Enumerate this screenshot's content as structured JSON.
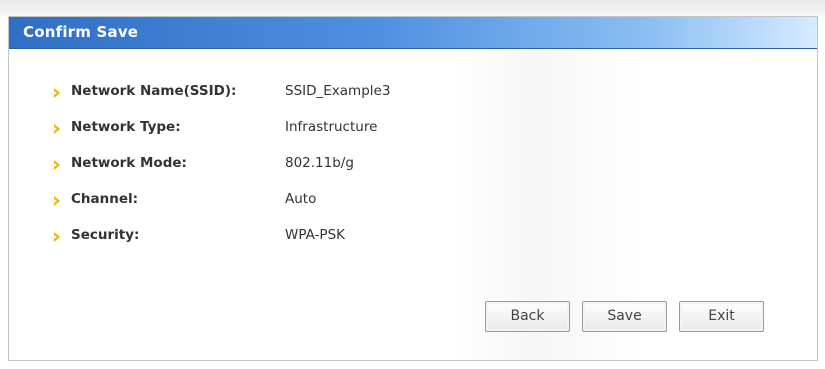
{
  "dialog": {
    "title": "Confirm Save"
  },
  "fields": [
    {
      "label": "Network Name(SSID):",
      "value": "SSID_Example3"
    },
    {
      "label": "Network Type:",
      "value": "Infrastructure"
    },
    {
      "label": "Network Mode:",
      "value": "802.11b/g"
    },
    {
      "label": "Channel:",
      "value": "Auto"
    },
    {
      "label": "Security:",
      "value": "WPA-PSK"
    }
  ],
  "buttons": {
    "back_label": "Back",
    "save_label": "Save",
    "exit_label": "Exit"
  },
  "colors": {
    "title_bar": "#4d8fe0",
    "bullet": "#f0b400"
  }
}
